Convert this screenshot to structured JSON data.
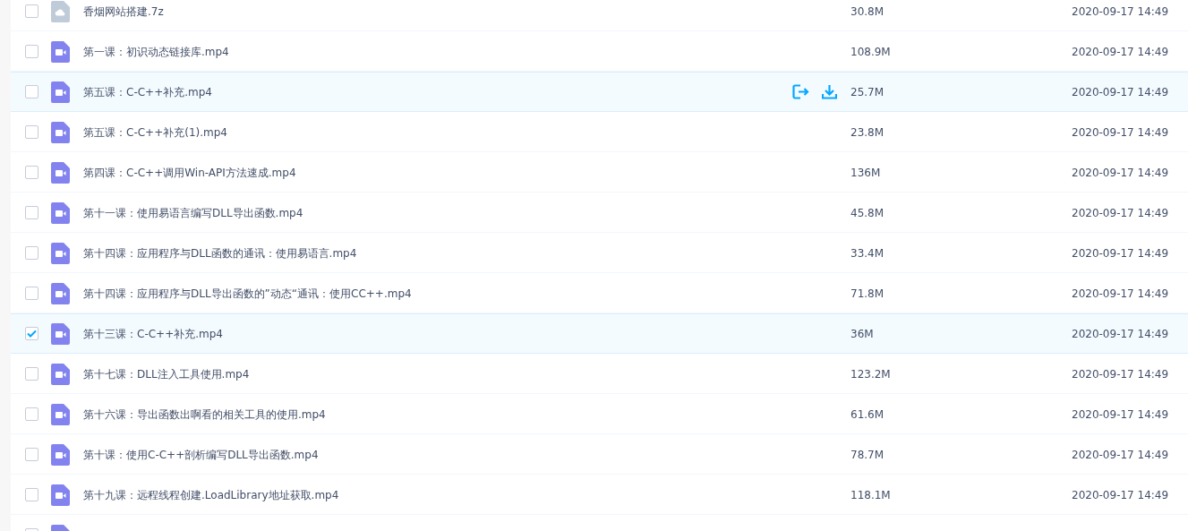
{
  "files": [
    {
      "kind": "archive",
      "name": "香烟网站搭建.7z",
      "size": "30.8M",
      "date": "2020-09-17 14:49",
      "checked": false,
      "hovered": false
    },
    {
      "kind": "video",
      "name": "第一课：初识动态链接库.mp4",
      "size": "108.9M",
      "date": "2020-09-17 14:49",
      "checked": false,
      "hovered": false
    },
    {
      "kind": "video",
      "name": "第五课：C-C++补充.mp4",
      "size": "25.7M",
      "date": "2020-09-17 14:49",
      "checked": false,
      "hovered": true
    },
    {
      "kind": "video",
      "name": "第五课：C-C++补充(1).mp4",
      "size": "23.8M",
      "date": "2020-09-17 14:49",
      "checked": false,
      "hovered": false
    },
    {
      "kind": "video",
      "name": "第四课：C-C++调用Win-API方法速成.mp4",
      "size": "136M",
      "date": "2020-09-17 14:49",
      "checked": false,
      "hovered": false
    },
    {
      "kind": "video",
      "name": "第十一课：使用易语言编写DLL导出函数.mp4",
      "size": "45.8M",
      "date": "2020-09-17 14:49",
      "checked": false,
      "hovered": false
    },
    {
      "kind": "video",
      "name": "第十四课：应用程序与DLL函数的通讯：使用易语言.mp4",
      "size": "33.4M",
      "date": "2020-09-17 14:49",
      "checked": false,
      "hovered": false
    },
    {
      "kind": "video",
      "name": "第十四课：应用程序与DLL导出函数的”动态“通讯：使用CC++.mp4",
      "size": "71.8M",
      "date": "2020-09-17 14:49",
      "checked": false,
      "hovered": false
    },
    {
      "kind": "video",
      "name": "第十三课：C-C++补充.mp4",
      "size": "36M",
      "date": "2020-09-17 14:49",
      "checked": true,
      "hovered": false
    },
    {
      "kind": "video",
      "name": "第十七课：DLL注入工具使用.mp4",
      "size": "123.2M",
      "date": "2020-09-17 14:49",
      "checked": false,
      "hovered": false
    },
    {
      "kind": "video",
      "name": "第十六课：导出函数出啊看的相关工具的使用.mp4",
      "size": "61.6M",
      "date": "2020-09-17 14:49",
      "checked": false,
      "hovered": false
    },
    {
      "kind": "video",
      "name": "第十课：使用C-C++剖析编写DLL导出函数.mp4",
      "size": "78.7M",
      "date": "2020-09-17 14:49",
      "checked": false,
      "hovered": false
    },
    {
      "kind": "video",
      "name": "第十九课：远程线程创建.LoadLibrary地址获取.mp4",
      "size": "118.1M",
      "date": "2020-09-17 14:49",
      "checked": false,
      "hovered": false
    },
    {
      "kind": "video",
      "hovered": false
    }
  ]
}
